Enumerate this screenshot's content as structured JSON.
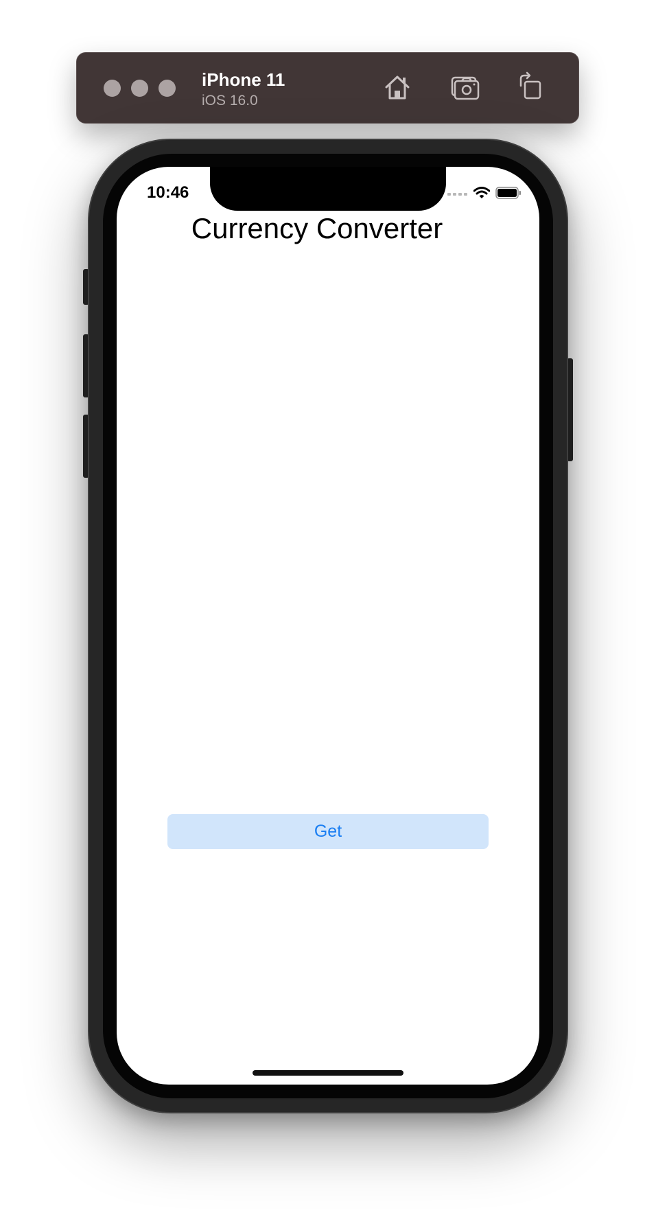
{
  "toolbar": {
    "device_name": "iPhone 11",
    "os_version": "iOS 16.0",
    "buttons": [
      "home-icon",
      "screenshot-icon",
      "rotate-icon"
    ]
  },
  "status_bar": {
    "time": "10:46"
  },
  "app": {
    "title": "Currency Converter",
    "get_button_label": "Get"
  },
  "colors": {
    "toolbar_bg": "#413636",
    "accent": "#1a7ef2",
    "button_bg": "#d1e5fb"
  }
}
